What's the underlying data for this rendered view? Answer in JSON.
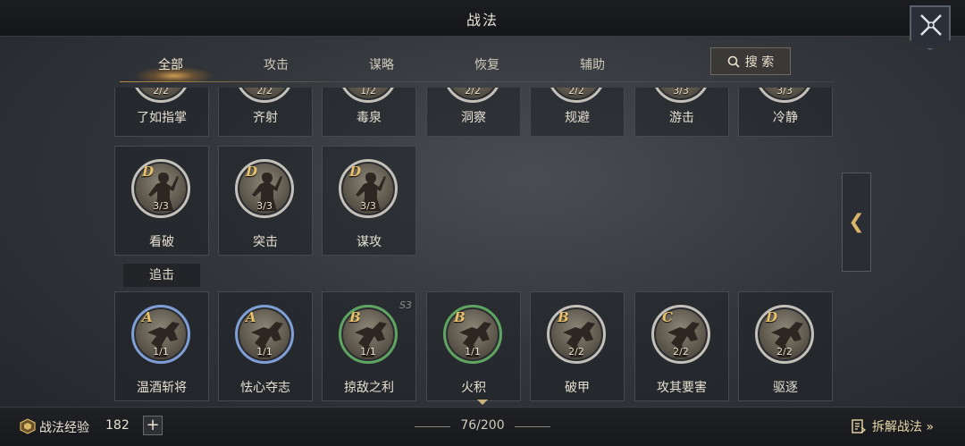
{
  "header": {
    "title": "战法"
  },
  "tabs": [
    {
      "label": "全部",
      "active": true
    },
    {
      "label": "攻击",
      "active": false
    },
    {
      "label": "谋略",
      "active": false
    },
    {
      "label": "恢复",
      "active": false
    },
    {
      "label": "辅助",
      "active": false
    }
  ],
  "search": {
    "label": "搜 索"
  },
  "row_top": [
    {
      "name": "了如指掌",
      "count": "2/2"
    },
    {
      "name": "齐射",
      "count": "2/2"
    },
    {
      "name": "毒泉",
      "count": "1/2"
    },
    {
      "name": "洞察",
      "count": "2/2"
    },
    {
      "name": "规避",
      "count": "2/2"
    },
    {
      "name": "游击",
      "count": "3/3"
    },
    {
      "name": "冷静",
      "count": "3/3"
    }
  ],
  "row_mid": [
    {
      "name": "看破",
      "grade": "D",
      "count": "3/3",
      "ring": "grey"
    },
    {
      "name": "突击",
      "grade": "D",
      "count": "3/3",
      "ring": "grey"
    },
    {
      "name": "谋攻",
      "grade": "D",
      "count": "3/3",
      "ring": "grey"
    }
  ],
  "section": {
    "label": "追击"
  },
  "row_bottom": [
    {
      "name": "温酒斩将",
      "grade": "A",
      "count": "1/1",
      "ring": "blue",
      "tag": ""
    },
    {
      "name": "怯心夺志",
      "grade": "A",
      "count": "1/1",
      "ring": "blue",
      "tag": ""
    },
    {
      "name": "掠敌之利",
      "grade": "B",
      "count": "1/1",
      "ring": "green",
      "tag": "S3"
    },
    {
      "name": "火积",
      "grade": "B",
      "count": "1/1",
      "ring": "green",
      "tag": ""
    },
    {
      "name": "破甲",
      "grade": "B",
      "count": "2/2",
      "ring": "grey",
      "tag": ""
    },
    {
      "name": "攻其要害",
      "grade": "C",
      "count": "2/2",
      "ring": "grey",
      "tag": ""
    },
    {
      "name": "驱逐",
      "grade": "D",
      "count": "2/2",
      "ring": "grey",
      "tag": ""
    }
  ],
  "side_handle": {
    "glyph": "❮"
  },
  "footer": {
    "exp_label": "战法经验",
    "exp_value": "182",
    "plus": "+",
    "page_count": "76/200",
    "dismantle_label": "拆解战法 »"
  },
  "colors": {
    "accent": "#d8b76a",
    "grade_text": "#e8c26a",
    "ring_blue": "#7f9ed6",
    "ring_green": "#5fa562"
  },
  "icons": [
    "close-swords-icon",
    "search-icon",
    "exp-badge-icon",
    "dismantle-icon",
    "chevron-left-icon",
    "caret-down-icon"
  ]
}
